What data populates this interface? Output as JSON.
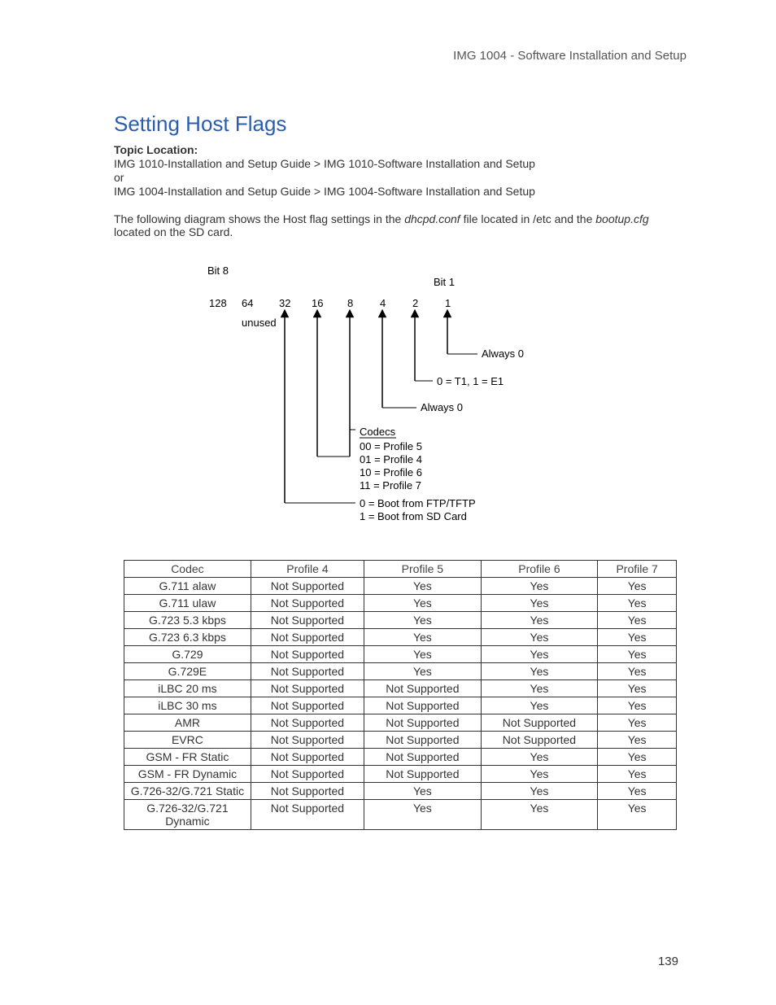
{
  "header_right": "IMG 1004 - Software Installation and Setup",
  "title": "Setting Host Flags",
  "topic_label": "Topic Location:",
  "topic_line1": "IMG 1010-Installation and Setup Guide  > IMG 1010-Software Installation and Setup",
  "topic_or": "or",
  "topic_line2": "IMG 1004-Installation and Setup Guide  > IMG 1004-Software Installation and Setup",
  "para_pre": "The following diagram shows the Host flag settings in the ",
  "para_mid1": "dhcpd.conf",
  "para_mid2": " file located in /etc and the ",
  "para_mid3": "bootup.cfg",
  "para_end": " located on the SD card.",
  "diagram": {
    "bit8": "Bit 8",
    "bit1": "Bit 1",
    "v128": "128",
    "v64": "64",
    "v32": "32",
    "v16": "16",
    "v8": "8",
    "v4": "4",
    "v2": "2",
    "v1": "1",
    "unused": "unused",
    "always0a": "Always 0",
    "t1e1": "0 = T1, 1 = E1",
    "always0b": "Always 0",
    "codecs": "Codecs",
    "codecs_l1": "00 = Profile 5",
    "codecs_l2": "01 = Profile 4",
    "codecs_l3": "10 = Profile 6",
    "codecs_l4": "11 = Profile 7",
    "boot_l1": "0 = Boot from FTP/TFTP",
    "boot_l2": "1 = Boot from SD Card"
  },
  "table": {
    "headers": [
      "Codec",
      "Profile 4",
      "Profile 5",
      "Profile 6",
      "Profile 7"
    ],
    "rows": [
      [
        "G.711 alaw",
        "Not Supported",
        "Yes",
        "Yes",
        "Yes"
      ],
      [
        "G.711 ulaw",
        "Not Supported",
        "Yes",
        "Yes",
        "Yes"
      ],
      [
        "G.723 5.3 kbps",
        "Not Supported",
        "Yes",
        "Yes",
        "Yes"
      ],
      [
        "G.723 6.3 kbps",
        "Not Supported",
        "Yes",
        "Yes",
        "Yes"
      ],
      [
        "G.729",
        "Not Supported",
        "Yes",
        "Yes",
        "Yes"
      ],
      [
        "G.729E",
        "Not Supported",
        "Yes",
        "Yes",
        "Yes"
      ],
      [
        "iLBC 20 ms",
        "Not Supported",
        "Not Supported",
        "Yes",
        "Yes"
      ],
      [
        "iLBC 30 ms",
        "Not Supported",
        "Not Supported",
        "Yes",
        "Yes"
      ],
      [
        "AMR",
        "Not Supported",
        "Not Supported",
        "Not Supported",
        "Yes"
      ],
      [
        "EVRC",
        "Not Supported",
        "Not Supported",
        "Not Supported",
        "Yes"
      ],
      [
        "GSM - FR Static",
        "Not Supported",
        "Not Supported",
        "Yes",
        "Yes"
      ],
      [
        "GSM - FR Dynamic",
        "Not Supported",
        "Not Supported",
        "Yes",
        "Yes"
      ],
      [
        "G.726-32/G.721 Static",
        "Not Supported",
        "Yes",
        "Yes",
        "Yes"
      ],
      [
        "G.726-32/G.721 Dynamic",
        "Not Supported",
        "Yes",
        "Yes",
        "Yes"
      ]
    ]
  },
  "page_number": "139"
}
